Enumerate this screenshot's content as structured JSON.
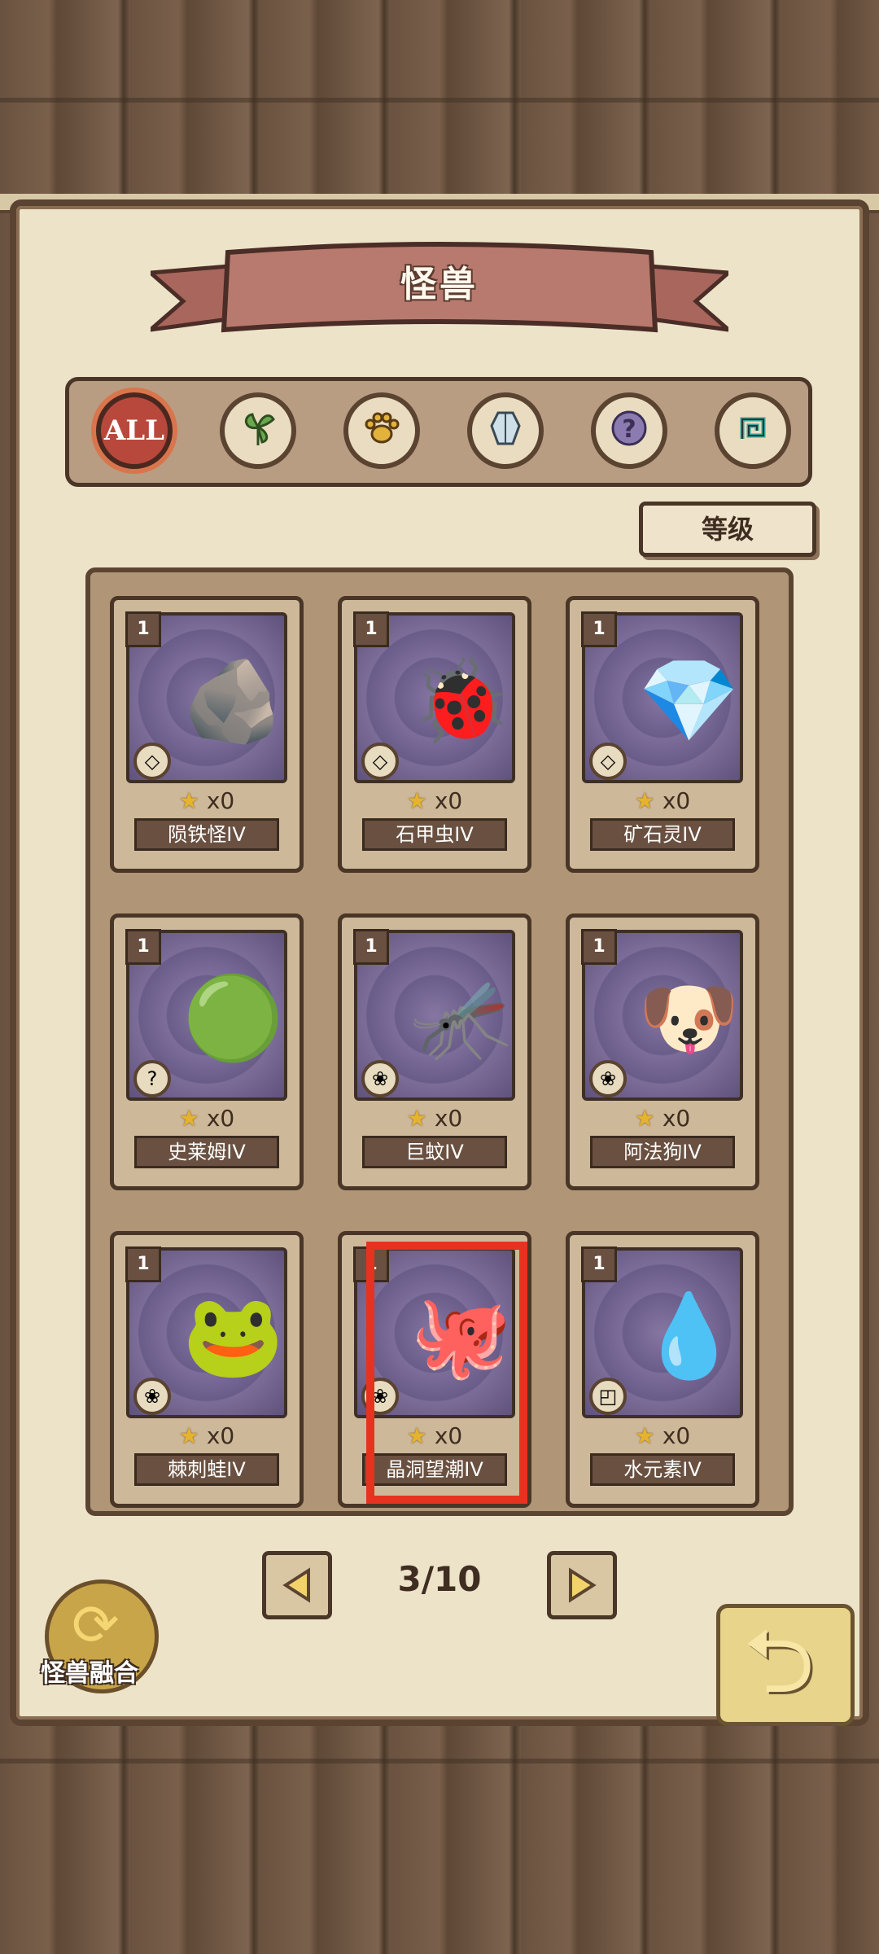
{
  "title": "怪兽",
  "filters": [
    {
      "label": "ALL",
      "icon": "all-icon",
      "active": true
    },
    {
      "label": "",
      "icon": "leaf-icon",
      "active": false
    },
    {
      "label": "",
      "icon": "paw-icon",
      "active": false
    },
    {
      "label": "",
      "icon": "crystal-icon",
      "active": false
    },
    {
      "label": "",
      "icon": "question-icon",
      "active": false
    },
    {
      "label": "",
      "icon": "spiral-icon",
      "active": false
    }
  ],
  "sort_label": "等级",
  "cards": [
    {
      "level": "1",
      "count": "x0",
      "name": "陨铁怪IV",
      "type_icon": "crystal-icon",
      "glyph": "🪨"
    },
    {
      "level": "1",
      "count": "x0",
      "name": "石甲虫IV",
      "type_icon": "crystal-icon",
      "glyph": "🐞"
    },
    {
      "level": "1",
      "count": "x0",
      "name": "矿石灵IV",
      "type_icon": "crystal-icon",
      "glyph": "💎"
    },
    {
      "level": "1",
      "count": "x0",
      "name": "史莱姆IV",
      "type_icon": "question-icon",
      "glyph": "🟢"
    },
    {
      "level": "1",
      "count": "x0",
      "name": "巨蚊IV",
      "type_icon": "paw-icon",
      "glyph": "🦟"
    },
    {
      "level": "1",
      "count": "x0",
      "name": "阿法狗IV",
      "type_icon": "paw-icon",
      "glyph": "🐶"
    },
    {
      "level": "1",
      "count": "x0",
      "name": "棘刺蛙IV",
      "type_icon": "paw-icon",
      "glyph": "🐸"
    },
    {
      "level": "1",
      "count": "x0",
      "name": "晶洞望潮IV",
      "type_icon": "paw-icon",
      "glyph": "🐙"
    },
    {
      "level": "1",
      "count": "x0",
      "name": "水元素IV",
      "type_icon": "spiral-icon",
      "glyph": "💧"
    }
  ],
  "pagination": {
    "label": "3/10",
    "current": 3,
    "total": 10
  },
  "fuse_label": "怪兽融合",
  "colors": {
    "highlight": "#e6321e",
    "ribbon": "#b87a6e",
    "card_art": "#6b5d8a"
  }
}
